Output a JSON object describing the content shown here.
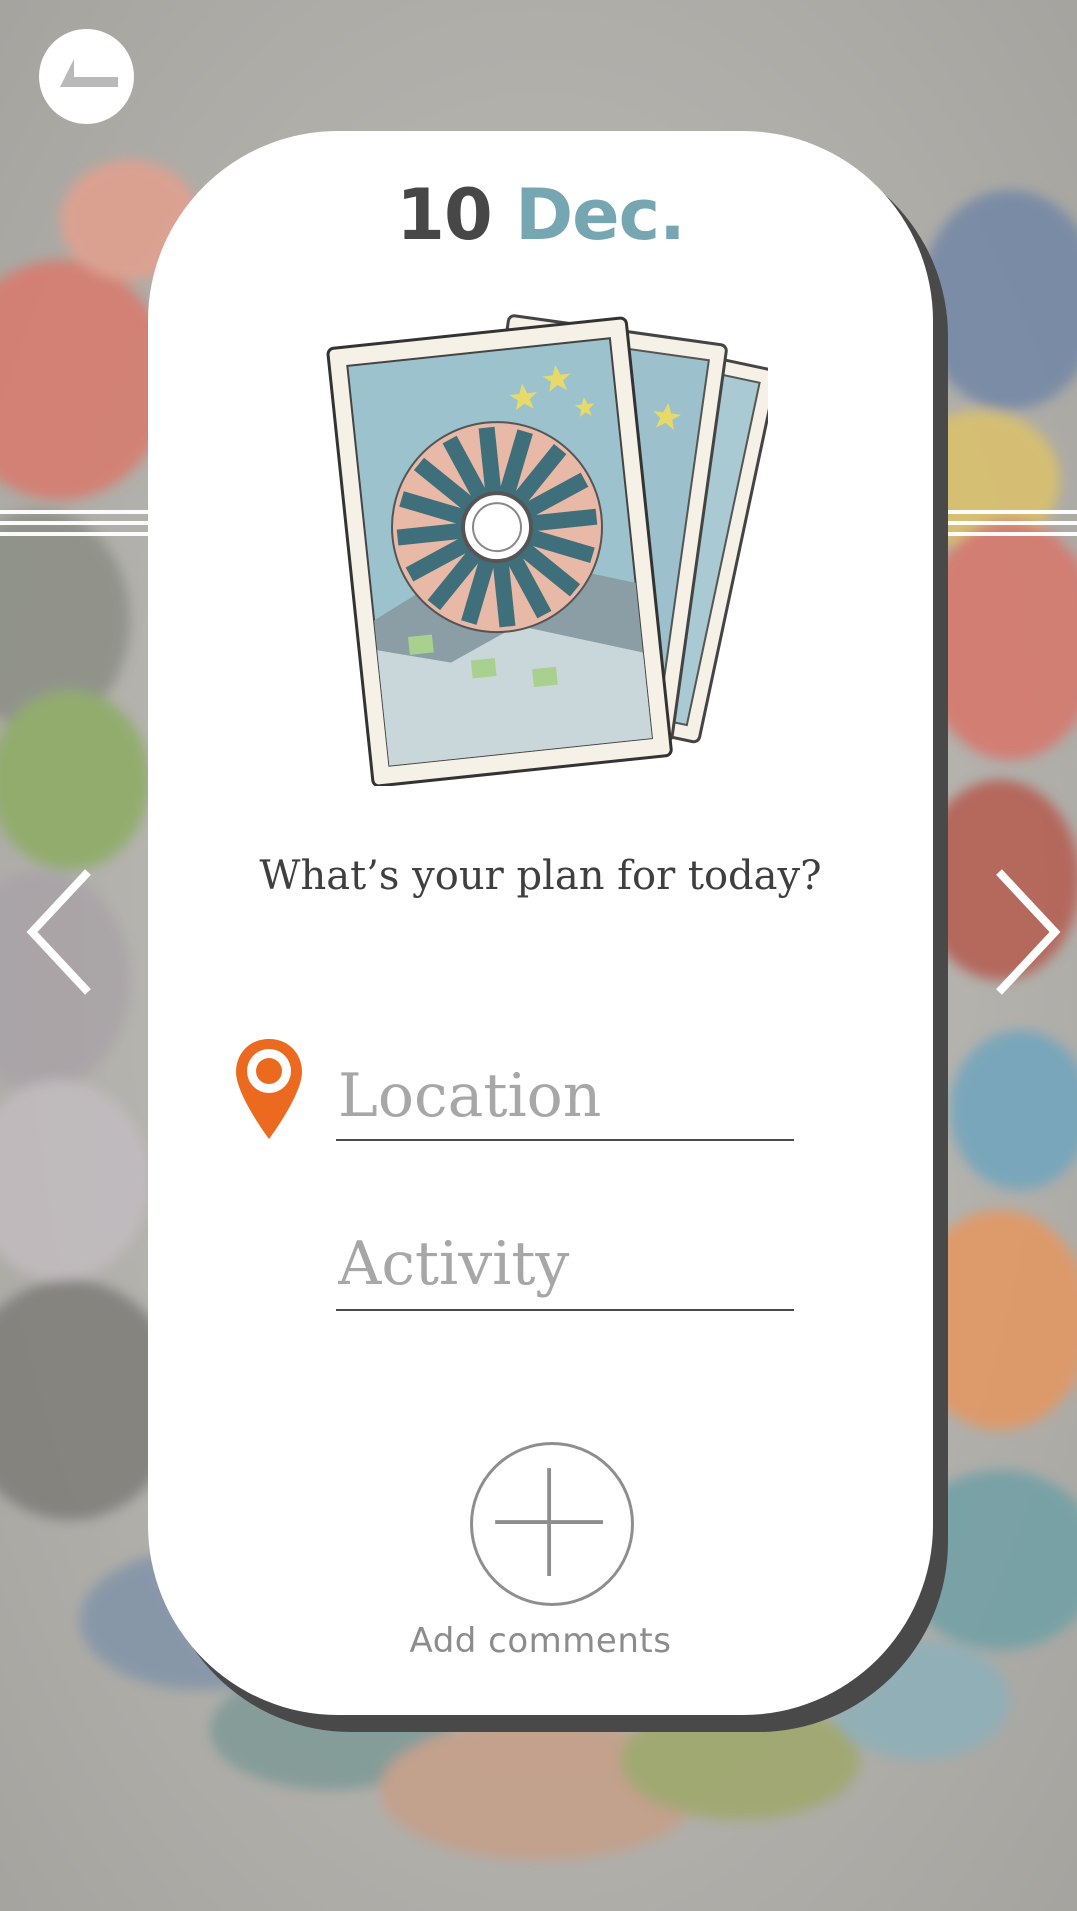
{
  "header": {
    "back_icon": "back-arrow-icon"
  },
  "date": {
    "day": "10",
    "month": "Dec."
  },
  "prompt": {
    "text": "What’s your plan for today?"
  },
  "form": {
    "location_placeholder": "Location",
    "location_value": "",
    "location_icon": "map-pin-icon",
    "activity_placeholder": "Activity",
    "activity_value": ""
  },
  "comments": {
    "add_label": "Add comments",
    "add_icon": "plus-icon"
  },
  "navigation": {
    "prev_icon": "chevron-left-icon",
    "next_icon": "chevron-right-icon"
  },
  "colors": {
    "accent_day": "#474747",
    "accent_month": "#76a6b2",
    "pin": "#ec6a1f",
    "card": "#ffffff",
    "card_shadow": "#4a4949",
    "background": "#a9a8a4"
  }
}
